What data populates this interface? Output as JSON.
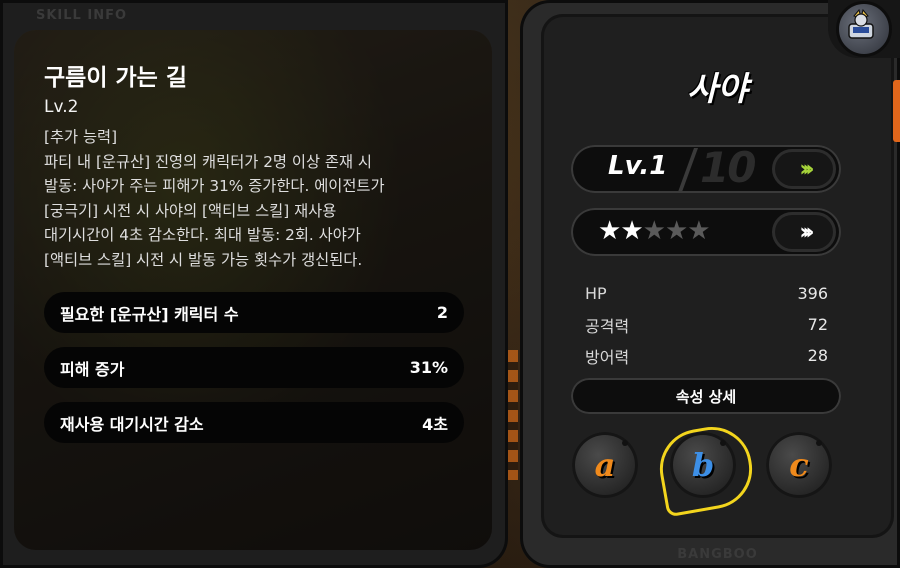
{
  "skill_panel": {
    "header": "SKILL INFO",
    "title": "구름이 가는 길",
    "level": "Lv.2",
    "description": "[추가 능력]\n파티 내 [운규산] 진영의 캐릭터가 2명 이상 존재 시\n발동: 사야가 주는 피해가 31% 증가한다. 에이전트가\n[궁극기] 시전 시 사야의 [액티브 스킬] 재사용\n대기시간이 4초 감소한다. 최대 발동: 2회. 사야가\n[액티브 스킬] 시전 시 발동 가능 횟수가 갱신된다.",
    "stats": [
      {
        "label": "필요한 [운규산] 캐릭터 수",
        "value": "2"
      },
      {
        "label": "피해 증가",
        "value": "31%"
      },
      {
        "label": "재사용 대기시간 감소",
        "value": "4초"
      }
    ]
  },
  "bangboo_panel": {
    "name": "사야",
    "level_label": "Lv.1",
    "level_max": "10",
    "level_button": "›››",
    "star_button": "›››",
    "stars_filled": 2,
    "stars_total": 5,
    "stats": [
      {
        "label": "HP",
        "value": "396"
      },
      {
        "label": "공격력",
        "value": "72"
      },
      {
        "label": "방어력",
        "value": "28"
      }
    ],
    "attribute_button": "속성 상세",
    "slots": [
      {
        "label": "a",
        "color": "#f08a1c"
      },
      {
        "label": "b",
        "color": "#3d8fe6",
        "selected": true
      },
      {
        "label": "c",
        "color": "#f08a1c"
      }
    ],
    "footer": "BANGBOO"
  },
  "colors": {
    "accent_green": "#a6d43a",
    "selected_yellow": "#f3d51d",
    "orange": "#e0661b"
  }
}
